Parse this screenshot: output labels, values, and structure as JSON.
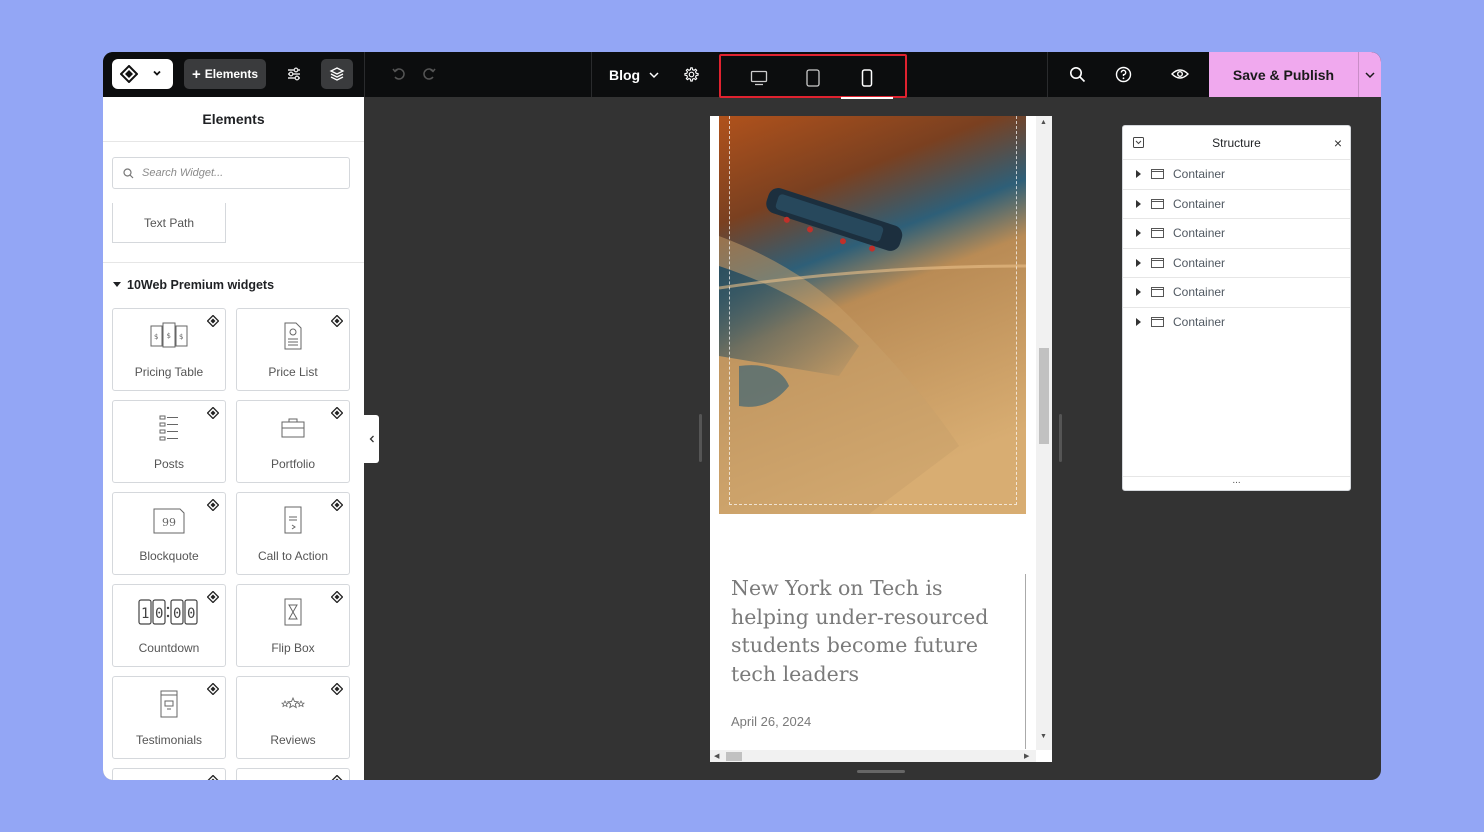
{
  "toolbar": {
    "elements_label": "Elements",
    "page_name": "Blog",
    "save_label": "Save & Publish"
  },
  "panel": {
    "title": "Elements",
    "search_placeholder": "Search Widget...",
    "text_path_label": "Text Path",
    "section_title": "10Web Premium widgets",
    "widgets": [
      {
        "label": "Pricing Table",
        "icon": "pricing-table-icon"
      },
      {
        "label": "Price List",
        "icon": "price-list-icon"
      },
      {
        "label": "Posts",
        "icon": "posts-icon"
      },
      {
        "label": "Portfolio",
        "icon": "portfolio-icon"
      },
      {
        "label": "Blockquote",
        "icon": "blockquote-icon"
      },
      {
        "label": "Call to Action",
        "icon": "call-to-action-icon"
      },
      {
        "label": "Countdown",
        "icon": "countdown-icon"
      },
      {
        "label": "Flip Box",
        "icon": "flip-box-icon"
      },
      {
        "label": "Testimonials",
        "icon": "testimonials-icon"
      },
      {
        "label": "Reviews",
        "icon": "reviews-icon"
      }
    ]
  },
  "preview": {
    "post_title": "New York on Tech is helping under-resourced students become future tech leaders",
    "post_date": "April 26, 2024"
  },
  "structure": {
    "title": "Structure",
    "footer": "...",
    "items": [
      {
        "label": "Container"
      },
      {
        "label": "Container"
      },
      {
        "label": "Container"
      },
      {
        "label": "Container"
      },
      {
        "label": "Container"
      },
      {
        "label": "Container"
      }
    ]
  },
  "colors": {
    "save_button": "#f0a9ee",
    "topbar": "#0c0d0e",
    "canvas": "#333333",
    "device_highlight": "#e0222f",
    "page_background": "#93a6f5"
  }
}
